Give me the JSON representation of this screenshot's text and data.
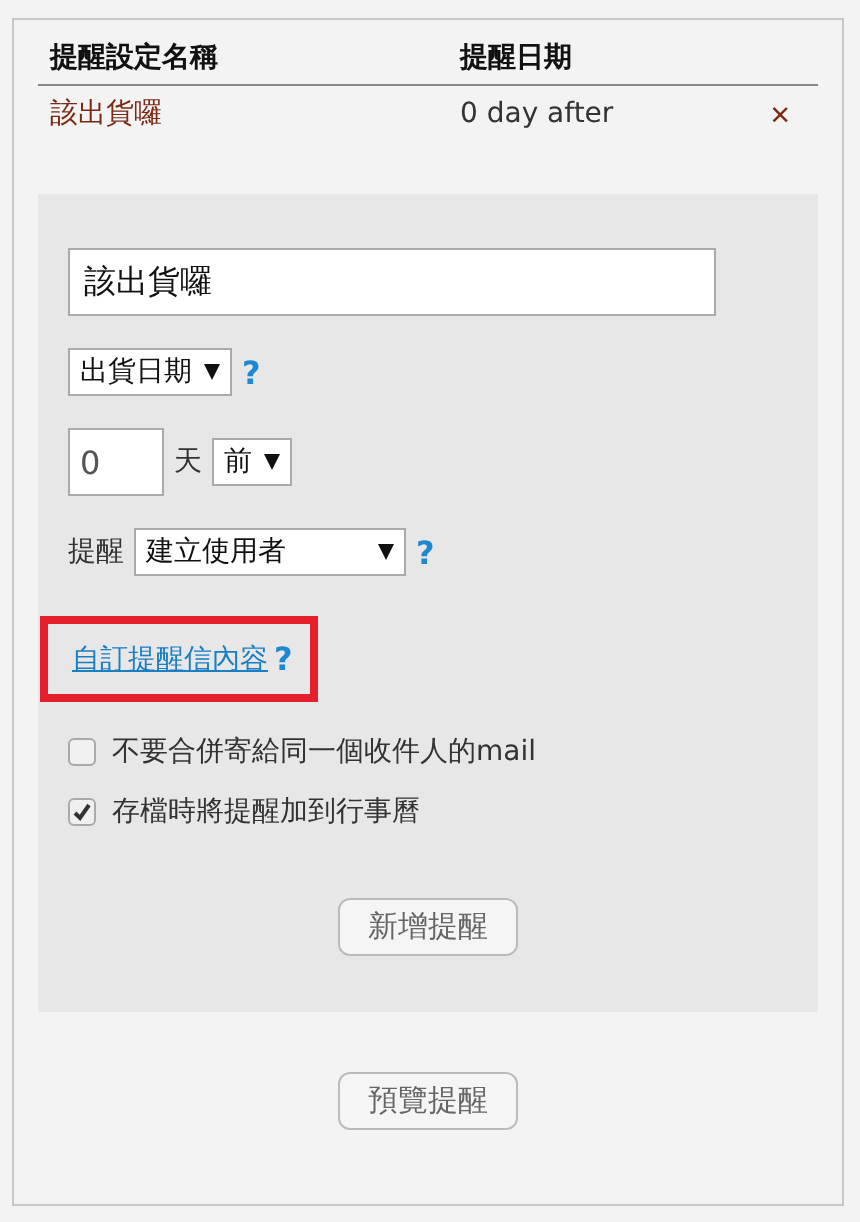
{
  "table": {
    "columns": [
      "提醒設定名稱",
      "提醒日期"
    ],
    "rows": [
      {
        "name": "該出貨囉",
        "date": "0 day after",
        "delete": "×"
      }
    ]
  },
  "form": {
    "name_value": "該出貨囉",
    "date_field": {
      "value": "出貨日期",
      "help": "?"
    },
    "offset": {
      "value": "0",
      "unit": "天",
      "direction": "前"
    },
    "recipient": {
      "label": "提醒",
      "value": "建立使用者",
      "help": "?"
    },
    "custom_link": {
      "label": "自訂提醒信內容",
      "help": "?",
      "highlighted": true
    },
    "options": [
      {
        "label": "不要合併寄給同一個收件人的mail",
        "checked": false
      },
      {
        "label": "存檔時將提醒加到行事曆",
        "checked": true
      }
    ],
    "add_button": "新增提醒"
  },
  "preview_button": "預覽提醒"
}
